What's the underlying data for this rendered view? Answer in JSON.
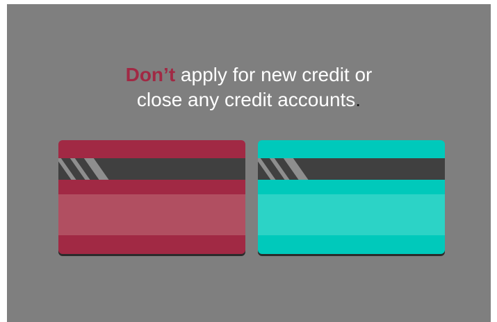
{
  "headline": {
    "emphasis": "Don’t",
    "line1_rest": " apply for new credit or",
    "line2": "close any credit accounts",
    "period": "."
  },
  "colors": {
    "background": "#7f7f7f",
    "emphasis": "#a12944",
    "period": "#1a1a1a",
    "stripe": "#404040",
    "card_left_primary": "#a12944",
    "card_left_secondary": "#b14f61",
    "card_right_primary": "#00c9bb",
    "card_right_secondary": "#2cd3c6"
  },
  "cards": [
    {
      "name": "card-red"
    },
    {
      "name": "card-teal"
    }
  ]
}
